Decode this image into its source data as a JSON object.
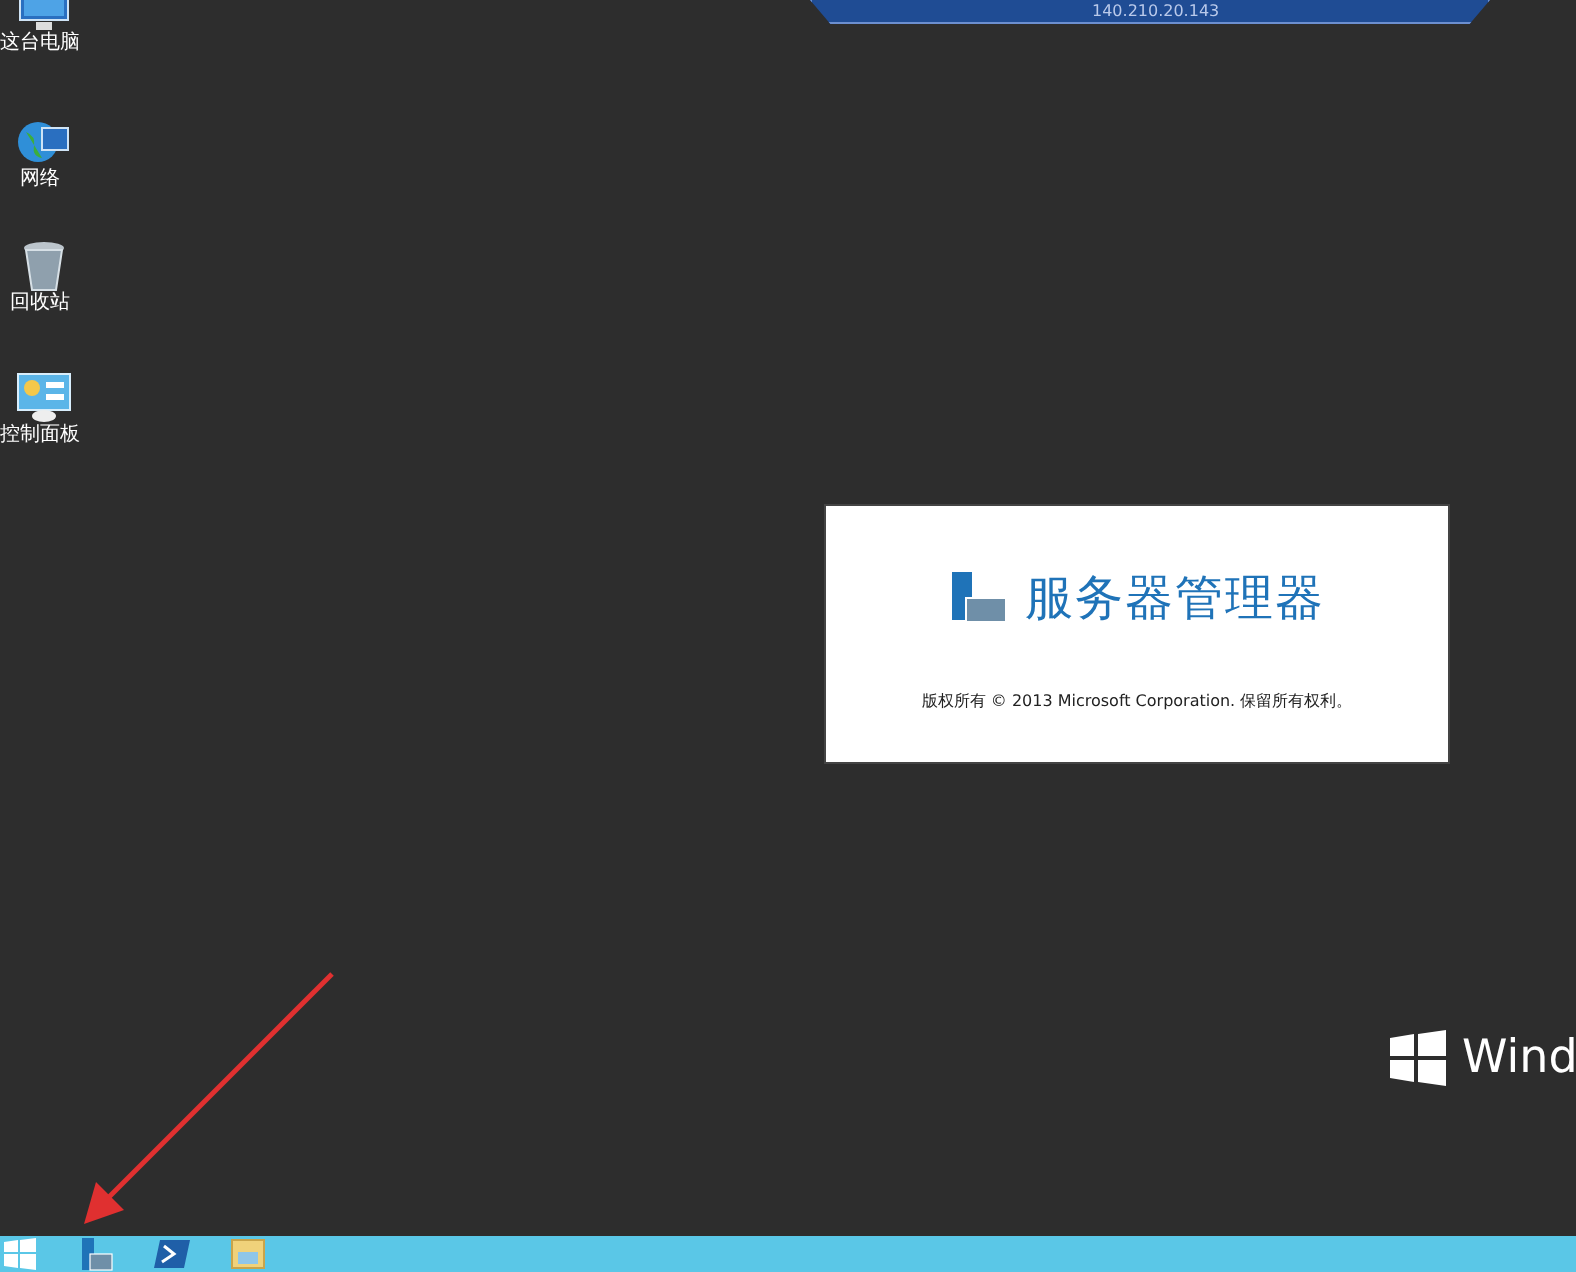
{
  "desktop_icons": [
    {
      "label": "这台电脑",
      "kind": "computer"
    },
    {
      "label": "网络",
      "kind": "network"
    },
    {
      "label": "回收站",
      "kind": "recycle"
    },
    {
      "label": "控制面板",
      "kind": "control"
    }
  ],
  "remote_bar": {
    "title": "140.210.20.143"
  },
  "splash": {
    "title": "服务器管理器",
    "copyright": "版权所有 © 2013  Microsoft Corporation. 保留所有权利。"
  },
  "branding": {
    "text": "Wind"
  },
  "taskbar": {
    "items": [
      {
        "kind": "start"
      },
      {
        "kind": "server-manager"
      },
      {
        "kind": "powershell"
      },
      {
        "kind": "explorer"
      }
    ]
  }
}
